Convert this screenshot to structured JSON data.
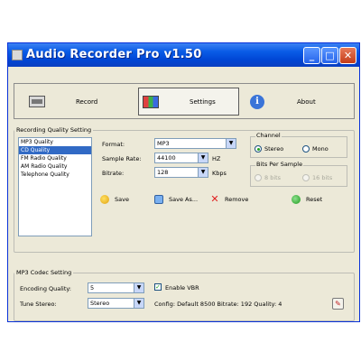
{
  "window": {
    "title": "Audio Recorder Pro v1.50",
    "controls": {
      "minimize": "_",
      "maximize": "□",
      "close": "✕"
    }
  },
  "toolbar": {
    "record_label": "Record",
    "settings_label": "Settings",
    "about_label": "About"
  },
  "recording_quality": {
    "legend": "Recording Quality Setting",
    "presets": [
      "MP3 Quality",
      "CD Quality",
      "FM Radio Quality",
      "AM Radio Quality",
      "Telephone Quality"
    ],
    "selected_index": 1,
    "format_label": "Format:",
    "format_value": "MP3",
    "sample_rate_label": "Sample Rate:",
    "sample_rate_value": "44100",
    "sample_rate_unit": "HZ",
    "bitrate_label": "Bitrate:",
    "bitrate_value": "128",
    "bitrate_unit": "Kbps",
    "channel_legend": "Channel",
    "channel_stereo": "Stereo",
    "channel_mono": "Mono",
    "channel_selected": "Stereo",
    "bits_legend": "Bits Per Sample",
    "bits_8": "8 bits",
    "bits_16": "16 bits",
    "save_label": "Save",
    "save_as_label": "Save As...",
    "remove_label": "Remove",
    "reset_label": "Reset"
  },
  "codec": {
    "legend": "MP3 Codec Setting",
    "encoding_quality_label": "Encoding Quality:",
    "encoding_quality_value": "5",
    "vbr_label": "Enable VBR",
    "vbr_checked": true,
    "tune_stereo_label": "Tune Stereo:",
    "tune_stereo_value": "Stereo",
    "config_text": "Config: Default 8500 Bitrate: 192 Quality: 4"
  },
  "icons": {
    "record": "tape-icon",
    "settings": "settings-icon",
    "about": "info-icon",
    "save": "save-icon",
    "save_as": "save-as-icon",
    "remove": "remove-icon",
    "reset": "reset-icon",
    "codec_config": "tool-icon"
  },
  "colors": {
    "titlebar": "#0a5ce6",
    "window_bg": "#ece9d8",
    "selection": "#316ac5",
    "close_button": "#c43c18"
  }
}
